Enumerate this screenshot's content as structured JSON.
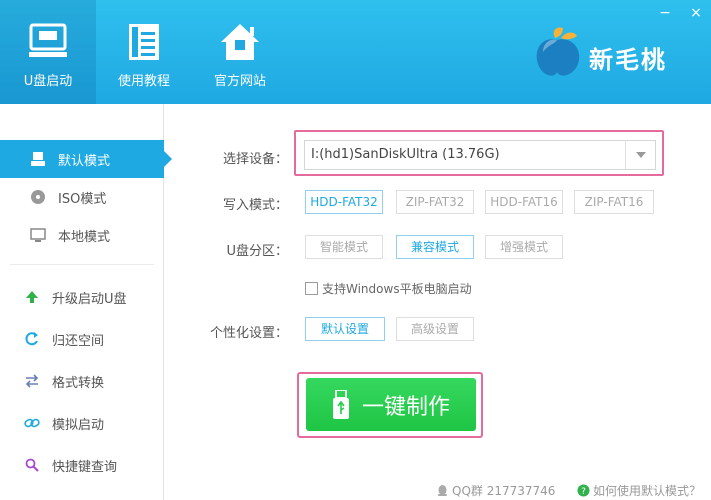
{
  "header": {
    "nav": [
      {
        "label": "U盘启动",
        "icon": "usb-monitor-icon"
      },
      {
        "label": "使用教程",
        "icon": "document-icon"
      },
      {
        "label": "官方网站",
        "icon": "home-icon"
      }
    ],
    "logo_text": "新毛桃",
    "accent": "#1fa8e2"
  },
  "window": {
    "minimize": "−",
    "close": "×"
  },
  "sidebar": {
    "items": [
      {
        "label": "默认模式",
        "icon": "usb-drive-icon",
        "active": true
      },
      {
        "label": "ISO模式",
        "icon": "disc-icon"
      },
      {
        "label": "本地模式",
        "icon": "monitor-icon"
      },
      {
        "label": "升级启动U盘",
        "icon": "upgrade-arrow-icon"
      },
      {
        "label": "归还空间",
        "icon": "restore-icon"
      },
      {
        "label": "格式转换",
        "icon": "convert-icon"
      },
      {
        "label": "模拟启动",
        "icon": "link-icon"
      },
      {
        "label": "快捷键查询",
        "icon": "search-icon"
      }
    ]
  },
  "main": {
    "device": {
      "label": "选择设备：",
      "value": "I:(hd1)SanDiskUltra (13.76G)"
    },
    "write_mode": {
      "label": "写入模式：",
      "options": [
        "HDD-FAT32",
        "ZIP-FAT32",
        "HDD-FAT16",
        "ZIP-FAT16"
      ],
      "selected": "HDD-FAT32"
    },
    "partition": {
      "label": "U盘分区：",
      "options": [
        "智能模式",
        "兼容模式",
        "增强模式"
      ],
      "selected": "兼容模式"
    },
    "windows_tablet": {
      "label": "支持Windows平板电脑启动",
      "checked": false
    },
    "personalize": {
      "label": "个性化设置：",
      "options": [
        "默认设置",
        "高级设置"
      ],
      "selected": "默认设置"
    },
    "make_button": "一键制作",
    "make_color": "#27cc4c",
    "highlight_color": "#e56b9c"
  },
  "footer": {
    "qq": "QQ群 217737746",
    "help": "如何使用默认模式？"
  }
}
